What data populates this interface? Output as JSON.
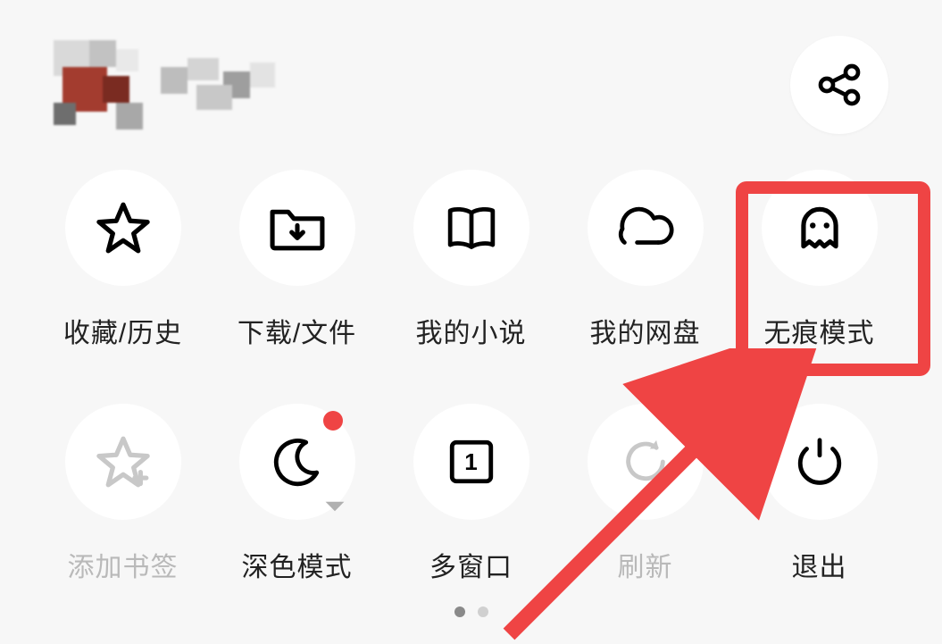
{
  "header": {
    "share_icon": "share-icon"
  },
  "grid": {
    "items": [
      {
        "id": "favorites-history",
        "label": "收藏/历史",
        "icon": "star-icon",
        "disabled": false
      },
      {
        "id": "download-files",
        "label": "下载/文件",
        "icon": "download-folder-icon",
        "disabled": false
      },
      {
        "id": "my-novels",
        "label": "我的小说",
        "icon": "book-icon",
        "disabled": false
      },
      {
        "id": "my-cloud",
        "label": "我的网盘",
        "icon": "cloud-icon",
        "disabled": false
      },
      {
        "id": "incognito-mode",
        "label": "无痕模式",
        "icon": "ghost-icon",
        "disabled": false
      },
      {
        "id": "add-bookmark",
        "label": "添加书签",
        "icon": "star-add-icon",
        "disabled": true
      },
      {
        "id": "dark-mode",
        "label": "深色模式",
        "icon": "moon-icon",
        "disabled": false,
        "badge": true,
        "dropdown": true
      },
      {
        "id": "multi-window",
        "label": "多窗口",
        "icon": "window-icon",
        "window_count": "1",
        "disabled": false
      },
      {
        "id": "refresh",
        "label": "刷新",
        "icon": "refresh-icon",
        "disabled": true
      },
      {
        "id": "exit",
        "label": "退出",
        "icon": "power-icon",
        "disabled": false
      }
    ]
  },
  "pager": {
    "current": 1,
    "total": 2
  },
  "annotations": {
    "highlight_target": "incognito-mode",
    "arrow_color": "#ef4444"
  }
}
